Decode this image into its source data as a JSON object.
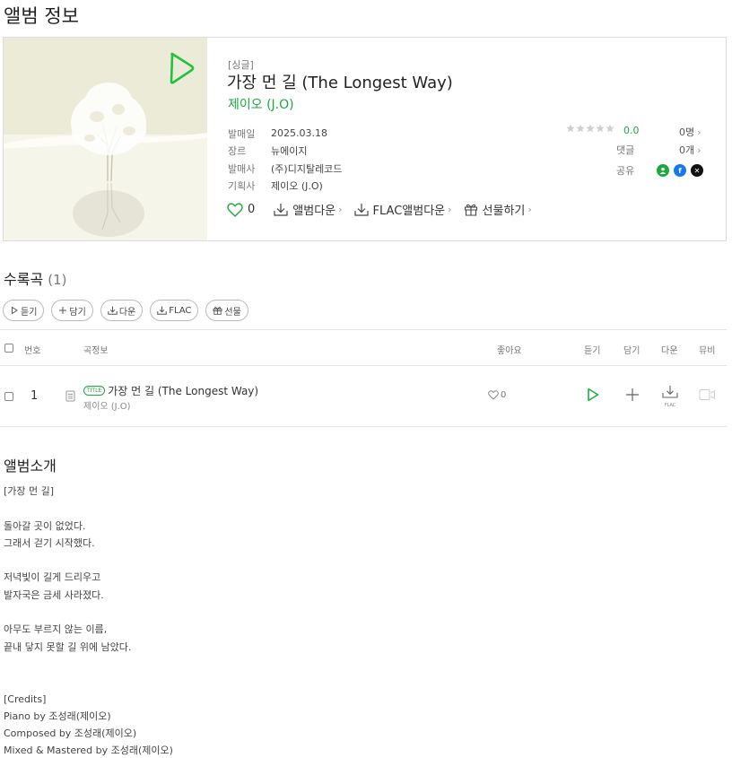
{
  "page": {
    "title": "앨범 정보"
  },
  "album": {
    "type": "[싱글]",
    "title": "가장 먼 길 (The Longest Way)",
    "artist": "제이오 (J.O)",
    "meta": [
      {
        "key": "발매일",
        "value": "2025.03.18"
      },
      {
        "key": "장르",
        "value": "뉴에이지"
      },
      {
        "key": "발매사",
        "value": "(주)디지탈레코드"
      },
      {
        "key": "기획사",
        "value": "제이오 (J.O)"
      }
    ],
    "rating": {
      "score": "0.0",
      "count": "0명",
      "stars_filled": 0,
      "stars_total": 5
    },
    "comments": {
      "label": "댓글",
      "count": "0개"
    },
    "share": {
      "label": "공유",
      "icons": [
        "share-person-icon",
        "facebook-icon",
        "x-icon"
      ]
    },
    "actions": {
      "likes": "0",
      "album_download": "앨범다운",
      "flac_download": "FLAC앨범다운",
      "gift": "선물하기"
    }
  },
  "tracklist": {
    "heading": "수록곡",
    "count": "(1)",
    "buttons": {
      "play": "듣기",
      "add": "담기",
      "download": "다운",
      "flac": "FLAC",
      "gift": "선물"
    },
    "columns": {
      "number": "번호",
      "info": "곡정보",
      "like": "좋아요",
      "play": "듣기",
      "add": "담기",
      "download": "다운",
      "mv": "뮤비"
    },
    "tracks": [
      {
        "number": "1",
        "badge": "TITLE",
        "title": "가장 먼 길 (The Longest Way)",
        "artist": "제이오 (J.O)",
        "likes": "0",
        "download_sub": "FLAC"
      }
    ]
  },
  "intro": {
    "heading": "앨범소개",
    "text": "[가장 먼 길]\n\n돌아갈 곳이 없었다.\n그래서 걷기 시작했다.\n\n저녁빛이 길게 드리우고\n발자국은 금세 사라졌다.\n\n아무도 부르지 않는 이름,\n끝내 닿지 못할 길 위에 남았다.\n\n\n[Credits]\nPiano by 조성래(제이오)\nComposed by 조성래(제이오)\nMixed & Mastered by 조성래(제이오)"
  },
  "colors": {
    "accent": "#1aaa3e",
    "border": "#dcdcdc",
    "facebook": "#1877f2",
    "x": "#111111"
  }
}
